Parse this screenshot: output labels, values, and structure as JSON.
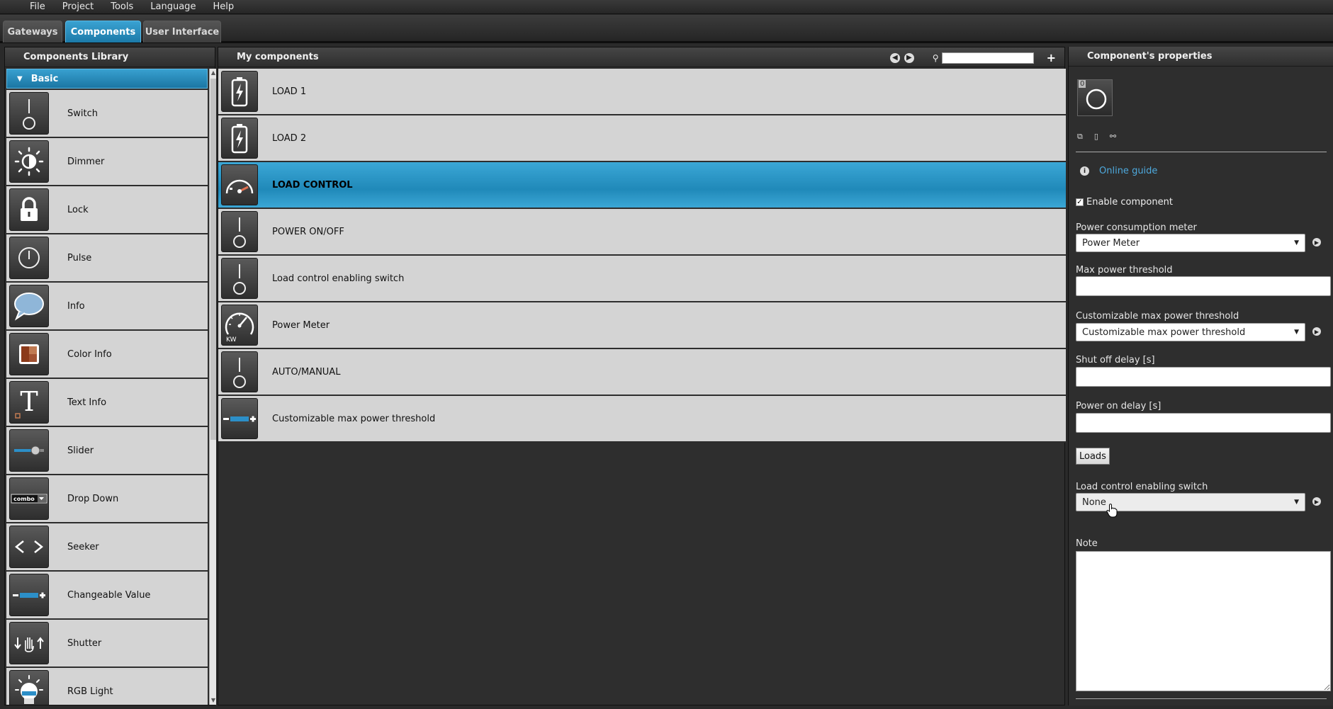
{
  "menu": [
    "File",
    "Project",
    "Tools",
    "Language",
    "Help"
  ],
  "tabs": [
    {
      "label": "Gateways",
      "active": false
    },
    {
      "label": "Components",
      "active": true
    },
    {
      "label": "User Interface",
      "active": false
    }
  ],
  "library": {
    "title": "Components Library",
    "category": "Basic",
    "items": [
      {
        "label": "Switch",
        "icon": "switch-icon"
      },
      {
        "label": "Dimmer",
        "icon": "dimmer-icon"
      },
      {
        "label": "Lock",
        "icon": "lock-icon"
      },
      {
        "label": "Pulse",
        "icon": "pulse-icon"
      },
      {
        "label": "Info",
        "icon": "speech-bubble-icon"
      },
      {
        "label": "Color Info",
        "icon": "color-info-icon"
      },
      {
        "label": "Text Info",
        "icon": "text-info-icon"
      },
      {
        "label": "Slider",
        "icon": "slider-icon"
      },
      {
        "label": "Drop Down",
        "icon": "combo-icon"
      },
      {
        "label": "Seeker",
        "icon": "seeker-icon"
      },
      {
        "label": "Changeable Value",
        "icon": "changeable-value-icon"
      },
      {
        "label": "Shutter",
        "icon": "shutter-icon"
      },
      {
        "label": "RGB Light",
        "icon": "rgb-light-icon"
      }
    ]
  },
  "my_components": {
    "title": "My components",
    "search_value": "",
    "items": [
      {
        "label": "LOAD 1",
        "icon": "battery-icon",
        "selected": false
      },
      {
        "label": "LOAD 2",
        "icon": "battery-icon",
        "selected": false
      },
      {
        "label": "LOAD CONTROL",
        "icon": "gauge-icon",
        "selected": true
      },
      {
        "label": "POWER ON/OFF",
        "icon": "switch-icon",
        "selected": false
      },
      {
        "label": "Load control enabling switch",
        "icon": "switch-icon",
        "selected": false
      },
      {
        "label": "Power Meter",
        "icon": "kw-gauge-icon",
        "selected": false
      },
      {
        "label": "AUTO/MANUAL",
        "icon": "switch-icon",
        "selected": false
      },
      {
        "label": "Customizable max power threshold",
        "icon": "changeable-value-icon",
        "selected": false
      }
    ]
  },
  "properties": {
    "title": "Component's properties",
    "preview_number": "0",
    "online_guide": "Online guide",
    "enable_label": "Enable component",
    "enabled": true,
    "power_meter_label": "Power consumption meter",
    "power_meter_value": "Power Meter",
    "max_threshold_label": "Max power threshold",
    "max_threshold_value": "",
    "custom_threshold_label": "Customizable max power threshold",
    "custom_threshold_value": "Customizable max power threshold",
    "shut_off_label": "Shut off delay [s]",
    "shut_off_value": "",
    "power_on_label": "Power on delay [s]",
    "power_on_value": "",
    "loads_button": "Loads",
    "enabling_switch_label": "Load control enabling switch",
    "enabling_switch_value": "None",
    "note_label": "Note",
    "note_value": ""
  },
  "icons": {
    "nav_prev": "arrow-left-icon",
    "nav_next": "arrow-right-icon",
    "search": "search-icon",
    "add": "plus-icon",
    "info": "info-icon",
    "copy": "copy-icon",
    "delete": "trash-icon",
    "link": "link-icon"
  },
  "colors": {
    "accent": "#2a92c4",
    "panel_bg": "#2e2e2e",
    "item_bg": "#d4d4d4",
    "link": "#4ea9dd"
  }
}
